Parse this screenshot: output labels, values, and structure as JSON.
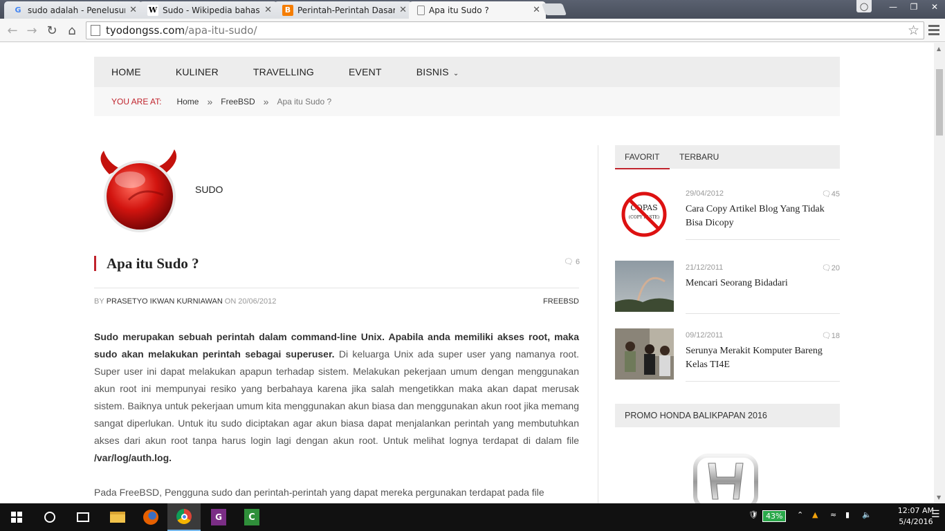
{
  "browser": {
    "tabs": [
      {
        "title": "sudo adalah - Penelusuran",
        "icon": "google-icon"
      },
      {
        "title": "Sudo - Wikipedia bahasa I",
        "icon": "wikipedia-icon"
      },
      {
        "title": "Perintah-Perintah Dasar di",
        "icon": "blogger-icon"
      },
      {
        "title": "Apa itu Sudo ?",
        "icon": "page-icon"
      }
    ],
    "url_host": "tyodongss.com",
    "url_path": "/apa-itu-sudo/"
  },
  "site": {
    "nav": [
      "HOME",
      "KULINER",
      "TRAVELLING",
      "EVENT",
      "BISNIS"
    ],
    "breadcrumb": {
      "label": "YOU ARE AT:",
      "items": [
        "Home",
        "FreeBSD",
        "Apa itu Sudo ?"
      ],
      "separator": "»"
    }
  },
  "article": {
    "logo_caption": "SUDO",
    "title": "Apa itu Sudo ?",
    "comments": "6",
    "meta_by": "BY",
    "author": "PRASETYO IKWAN KURNIAWAN",
    "meta_on": "ON",
    "date": "20/06/2012",
    "category": "FREEBSD",
    "p1_bold": "Sudo merupakan sebuah perintah dalam command-line Unix. Apabila anda memiliki akses root, maka sudo akan melakukan perintah sebagai superuser.",
    "p1_text": " Di keluarga Unix ada super user yang namanya root. Super user ini dapat melakukan apapun terhadap sistem. Melakukan pekerjaan umum dengan menggunakan akun root ini mempunyai resiko yang berbahaya karena jika salah mengetikkan maka akan dapat merusak sistem. Baiknya untuk pekerjaan umum kita menggunakan akun biasa dan menggunakan akun root jika memang sangat diperlukan. Untuk itu sudo diciptakan agar akun biasa dapat menjalankan perintah yang membutuhkan akses dari akun root tanpa harus login lagi dengan akun root. Untuk melihat lognya terdapat di dalam file ",
    "p1_path": "/var/log/auth.log.",
    "p2_text": "Pada FreeBSD, Pengguna sudo dan perintah-perintah yang dapat mereka pergunakan terdapat pada file"
  },
  "sidebar": {
    "tabs": [
      "FAVORIT",
      "TERBARU"
    ],
    "posts": [
      {
        "date": "29/04/2012",
        "comments": "45",
        "title": "Cara Copy Artikel Blog Yang Tidak Bisa Dicopy",
        "thumb_text": "COPAS",
        "thumb_sub": "(COPY PASTE)"
      },
      {
        "date": "21/12/2011",
        "comments": "20",
        "title": "Mencari Seorang Bidadari"
      },
      {
        "date": "09/12/2011",
        "comments": "18",
        "title": "Serunya Merakit Komputer Bareng Kelas TI4E"
      }
    ],
    "promo_title": "PROMO HONDA BALIKPAPAN 2016"
  },
  "taskbar": {
    "battery": "43%",
    "time": "12:07 AM",
    "date": "5/4/2016"
  },
  "colors": {
    "accent": "#c0232c",
    "nav_bg": "#ededed"
  }
}
